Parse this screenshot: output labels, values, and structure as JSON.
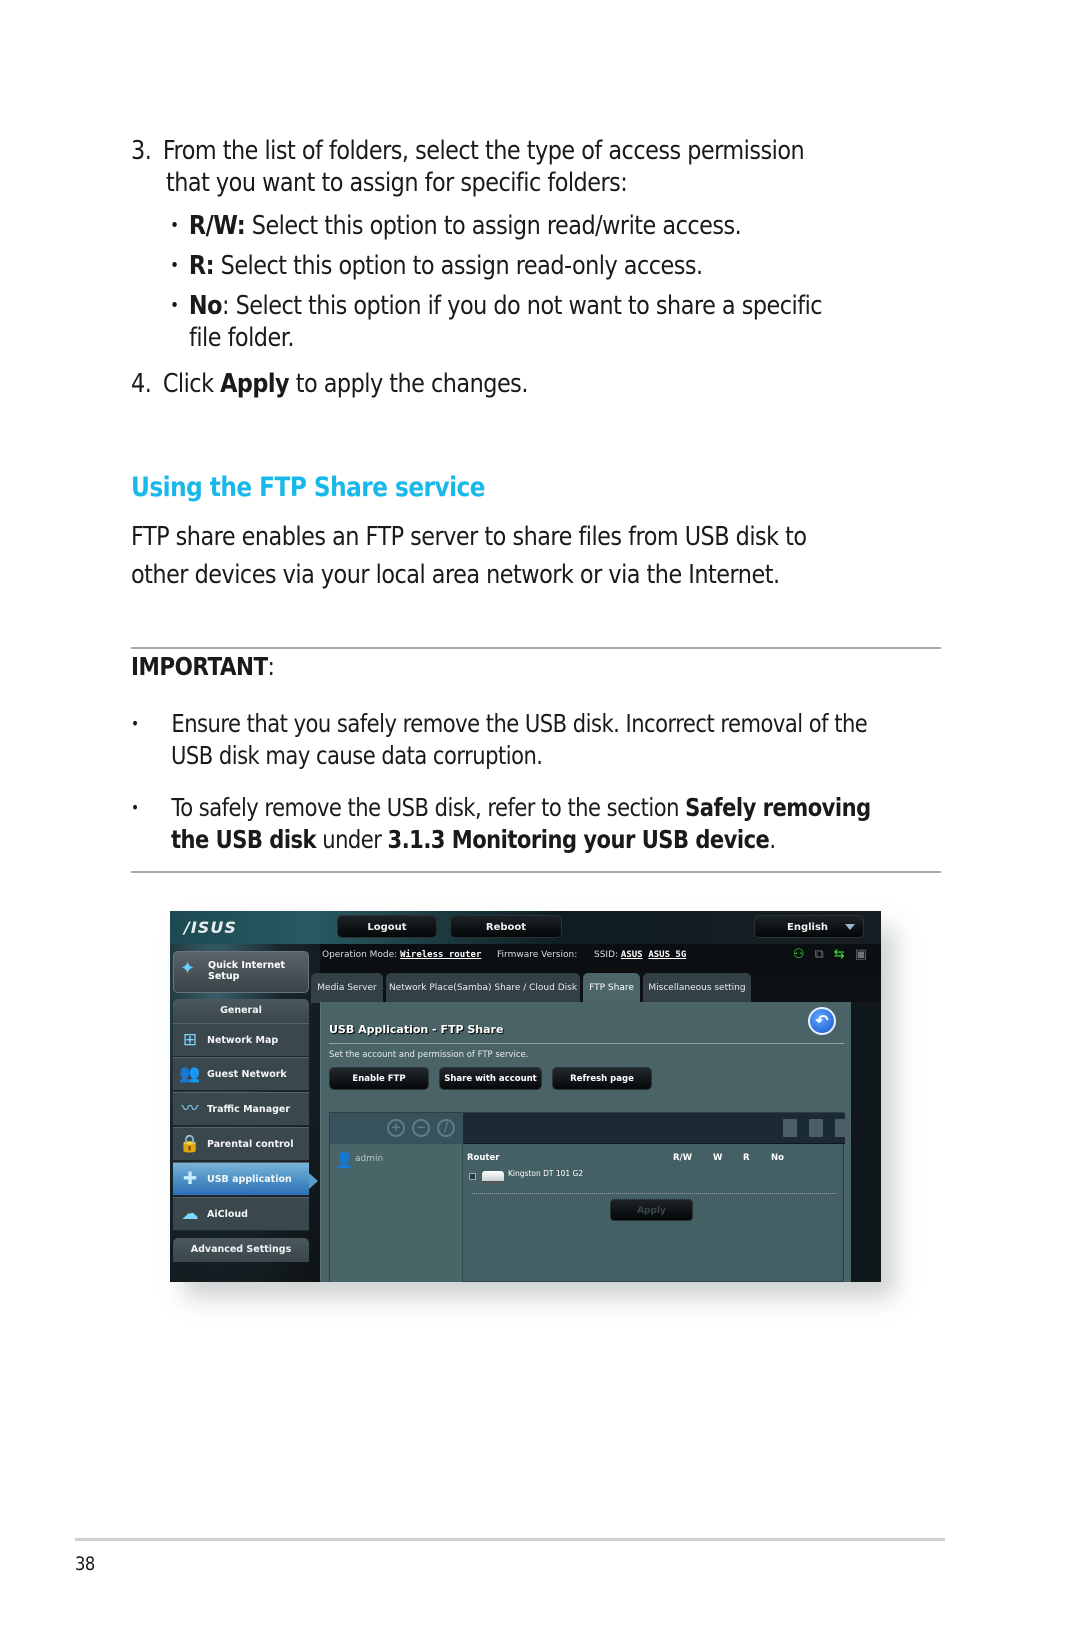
{
  "steps": [
    {
      "number": "3.",
      "line1": "From the list of folders, select the type of access permission",
      "line2": "that you want to assign for specific folders:",
      "bullets": [
        {
          "term": "R/W:",
          "text": " Select this option to assign read/write access."
        },
        {
          "term": "R:",
          "text": " Select this option to assign read-only access."
        },
        {
          "term": "No",
          "text": ":  Select this option if you do not want to share a specific",
          "text2": "file folder."
        }
      ]
    },
    {
      "number": "4.",
      "pre": "Click ",
      "term": "Apply",
      "post": " to apply the changes."
    }
  ],
  "section": {
    "heading": "Using the FTP Share service",
    "para_line1": "FTP share enables an FTP server to share files from USB disk to",
    "para_line2": "other devices via your local area network or via the Internet."
  },
  "important": {
    "title": "IMPORTANT",
    "colon": ":",
    "items": [
      {
        "line1": "Ensure that you safely remove the USB disk. Incorrect removal of the",
        "line2": "USB disk may cause data corruption."
      },
      {
        "pre": "To safely remove the USB disk, refer to the section ",
        "bold1": "Safely removing",
        "bold2": "the USB disk",
        "mid": " under ",
        "bold3": "3.1.3 Monitoring your USB device",
        "post": "."
      }
    ]
  },
  "router_ui": {
    "logo": "/ISUS",
    "header_buttons": {
      "logout": "Logout",
      "reboot": "Reboot",
      "language": "English"
    },
    "operation_mode_label": "Operation Mode:",
    "operation_mode_value": "Wireless router",
    "firmware_label": "Firmware Version:",
    "ssid_label": "SSID:",
    "ssid_values": [
      "ASUS",
      "ASUS_5G"
    ],
    "status_icons": [
      "clients-icon",
      "network-icon",
      "usb-icon",
      "printer-icon"
    ],
    "sidebar": {
      "quick_setup": "Quick Internet Setup",
      "general_header": "General",
      "items": [
        {
          "label": "Network Map",
          "icon": "network-map-icon"
        },
        {
          "label": "Guest Network",
          "icon": "guest-network-icon"
        },
        {
          "label": "Traffic Manager",
          "icon": "traffic-manager-icon"
        },
        {
          "label": "Parental control",
          "icon": "lock-icon"
        },
        {
          "label": "USB application",
          "icon": "puzzle-icon",
          "active": true
        },
        {
          "label": "AiCloud",
          "icon": "cloud-icon"
        }
      ],
      "advanced_header": "Advanced Settings"
    },
    "tabs": [
      {
        "label": "Media Server"
      },
      {
        "label": "Network Place(Samba) Share / Cloud Disk"
      },
      {
        "label": "FTP Share",
        "active": true
      },
      {
        "label": "Miscellaneous setting"
      }
    ],
    "panel": {
      "title": "USB Application - FTP Share",
      "description": "Set the account and permission of FTP service.",
      "buttons": [
        "Enable FTP",
        "Share with account",
        "Refresh page"
      ],
      "account": "admin",
      "tree_root": "Router",
      "permission_columns": [
        "R/W",
        "W",
        "R",
        "No"
      ],
      "drive": "Kingston DT 101 G2",
      "apply": "Apply"
    }
  },
  "page_number": "38",
  "colors": {
    "heading_accent": "#18b9ea",
    "active_sidebar": "#4e91c6",
    "status_green": "#3ee83a"
  }
}
